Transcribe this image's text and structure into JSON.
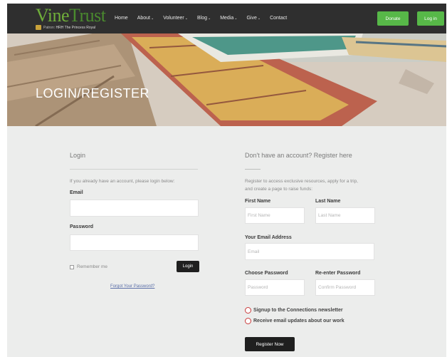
{
  "header": {
    "logo": {
      "vine": "Vine",
      "trust": "Trust",
      "patron_prefix": "Patron:",
      "patron_name": "HRH The Princess Royal"
    },
    "nav": [
      {
        "label": "Home",
        "dropdown": false
      },
      {
        "label": "About",
        "dropdown": true
      },
      {
        "label": "Volunteer",
        "dropdown": true
      },
      {
        "label": "Blog",
        "dropdown": true
      },
      {
        "label": "Media",
        "dropdown": true
      },
      {
        "label": "Give",
        "dropdown": true
      },
      {
        "label": "Contact",
        "dropdown": false
      }
    ],
    "donate_label": "Donate",
    "login_label": "Log in"
  },
  "hero": {
    "title": "LOGIN/REGISTER"
  },
  "login": {
    "heading": "Login",
    "intro": "If you already have an account, please login below:",
    "email_label": "Email",
    "email_value": "",
    "password_label": "Password",
    "password_value": "",
    "remember_label": "Remember me",
    "login_button": "Login",
    "forgot_link": "Forgot Your Password?"
  },
  "register": {
    "heading": "Don't have an account? Register here",
    "intro_line1": "Register to access exclusive resources, apply for a trip,",
    "intro_line2": "and create a page to raise funds:",
    "first_name_label": "First Name",
    "first_name_placeholder": "First Name",
    "last_name_label": "Last Name",
    "last_name_placeholder": "Last Name",
    "email_label": "Your Email Address",
    "email_placeholder": "Email",
    "password_label": "Choose Password",
    "password_placeholder": "Password",
    "confirm_label": "Re-enter Password",
    "confirm_placeholder": "Confirm Password",
    "newsletter_label": "Signup to the Connections newsletter",
    "updates_label": "Receive email updates about our work",
    "register_button": "Register Now"
  },
  "colors": {
    "header_bg": "#2f2f2f",
    "accent_green": "#57b848",
    "content_bg": "#ecedec",
    "radio_red": "#c83a3a",
    "button_dark": "#1f1f1f"
  }
}
